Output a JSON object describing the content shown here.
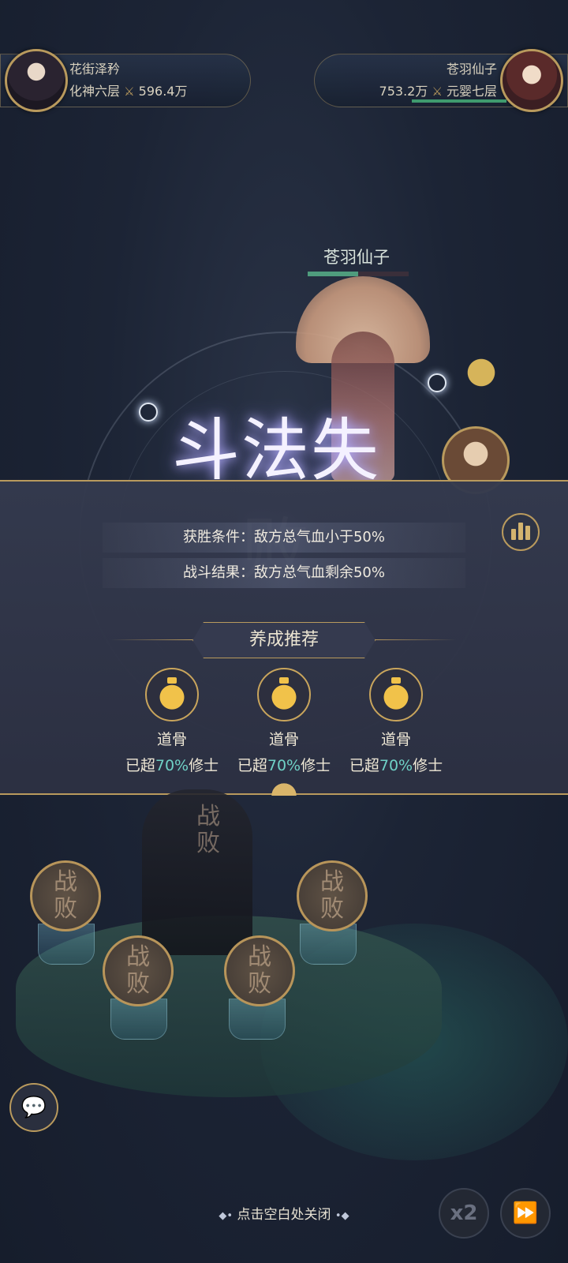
{
  "left_player": {
    "name": "花街泽矜",
    "realm": "化神六层",
    "power": "596.4万"
  },
  "right_player": {
    "name": "苍羽仙子",
    "realm": "元婴七层",
    "power": "753.2万"
  },
  "enemy": {
    "name": "苍羽仙子",
    "hp_fraction": 0.5
  },
  "result": {
    "title": "斗法失败",
    "win_condition": "获胜条件：敌方总气血小于50%",
    "battle_result": "战斗结果：敌方总气血剩余50%"
  },
  "recommend": {
    "header": "养成推荐",
    "items": [
      {
        "name": "道骨",
        "prefix": "已超",
        "percent": "70%",
        "suffix": "修士"
      },
      {
        "name": "道骨",
        "prefix": "已超",
        "percent": "70%",
        "suffix": "修士"
      },
      {
        "name": "道骨",
        "prefix": "已超",
        "percent": "70%",
        "suffix": "修士"
      }
    ]
  },
  "defeat": {
    "line1": "战",
    "line2": "败"
  },
  "bottom": {
    "close_hint": "点击空白处关闭",
    "speed_label": "x2",
    "skip_icon": "fast-forward-icon",
    "chat_icon": "chat-bubble-icon"
  },
  "colors": {
    "gold": "#b99a5d",
    "percent_teal": "#6fd1c6",
    "hp_green": "#4f9c7d"
  }
}
